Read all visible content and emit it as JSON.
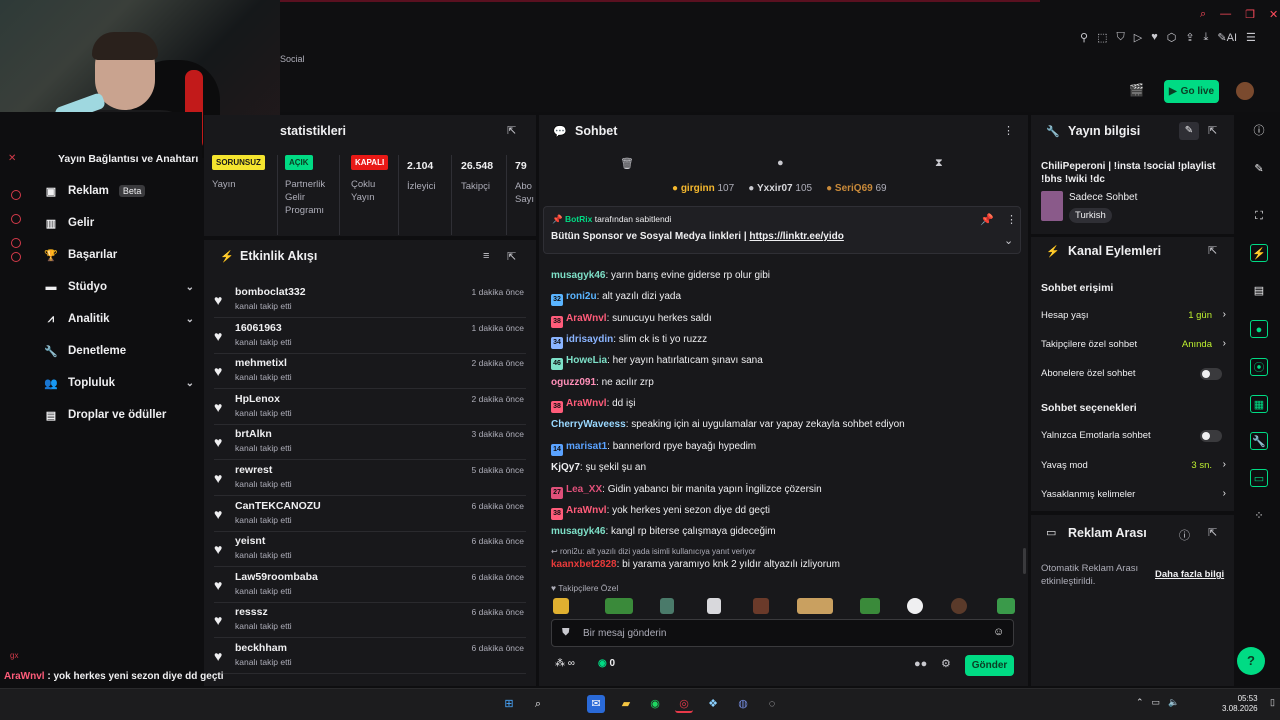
{
  "topbar": {
    "social_fragment": "Social",
    "go_live": "Go live"
  },
  "sidenav": {
    "partial_item": "Yayın Bağlantısı ve Anahtarı",
    "items": [
      {
        "label": "Reklam",
        "badge": "Beta",
        "icon": "megaphone-icon"
      },
      {
        "label": "Gelir",
        "icon": "revenue-icon"
      },
      {
        "label": "Başarılar",
        "icon": "trophy-icon"
      },
      {
        "label": "Stüdyo",
        "icon": "studio-icon"
      },
      {
        "label": "Analitik",
        "icon": "chart-icon"
      },
      {
        "label": "Denetleme",
        "icon": "wrench-icon"
      },
      {
        "label": "Topluluk",
        "icon": "community-icon"
      },
      {
        "label": "Droplar ve ödüller",
        "icon": "gift-icon"
      }
    ]
  },
  "stats": {
    "title_fragment": "statistikleri",
    "cells": [
      {
        "badge": "SORUNSUZ",
        "label": "Yayın"
      },
      {
        "badge": "AÇIK",
        "label": "Partnerlik Gelir Programı"
      },
      {
        "badge": "KAPALI",
        "label": "Çoklu Yayın"
      },
      {
        "value": "2.104",
        "label": "İzleyici"
      },
      {
        "value": "26.548",
        "label": "Takipçi"
      },
      {
        "value": "79",
        "label": "Abo Sayı"
      }
    ]
  },
  "activity": {
    "title": "Etkinlik Akışı",
    "sub": "kanalı takip etti",
    "rows": [
      {
        "name": "bomboclat332",
        "time": "1 dakika önce"
      },
      {
        "name": "16061963",
        "time": "1 dakika önce"
      },
      {
        "name": "mehmetixl",
        "time": "2 dakika önce"
      },
      {
        "name": "HpLenox",
        "time": "2 dakika önce"
      },
      {
        "name": "brtAlkn",
        "time": "3 dakika önce"
      },
      {
        "name": "rewrest",
        "time": "5 dakika önce"
      },
      {
        "name": "CanTEKCANOZU",
        "time": "6 dakika önce"
      },
      {
        "name": "yeisnt",
        "time": "6 dakika önce"
      },
      {
        "name": "Law59roombaba",
        "time": "6 dakika önce"
      },
      {
        "name": "resssz",
        "time": "6 dakika önce"
      },
      {
        "name": "beckhham",
        "time": "6 dakika önce"
      }
    ]
  },
  "chat": {
    "title": "Sohbet",
    "leaders": [
      {
        "name": "girginn",
        "count": "107"
      },
      {
        "name": "Yxxir07",
        "count": "105"
      },
      {
        "name": "SeriQ69",
        "count": "69"
      }
    ],
    "pinned_by": "BotRix",
    "pinned_suffix": "tarafından sabitlendi",
    "pinned_text": "Bütün Sponsor ve Sosyal Medya linkleri |",
    "pinned_link": "https://linktr.ee/yido",
    "messages": [
      {
        "user": "musagyk46",
        "text": ": yarın barış evine giderse rp olur gibi",
        "color": "#7ee0c8",
        "badge": ""
      },
      {
        "user": "roni2u",
        "text": ": alt yazılı dizi yada",
        "color": "#5ab4ff",
        "badge": "32"
      },
      {
        "user": "AraWnvl",
        "text": ": sunucuyu herkes saldı",
        "color": "#ff5c7a",
        "badge": "38"
      },
      {
        "user": "idrisaydin",
        "text": ": slim ck is ti yo ruzzz",
        "color": "#8ab4ff",
        "badge": "34"
      },
      {
        "user": "HoweLia",
        "text": ": her yayın hatırlatıcam şınavı sana",
        "color": "#7ee0c8",
        "badge": "46"
      },
      {
        "user": "oguzz091",
        "text": ": ne acılır zrp",
        "color": "#ff8fb8",
        "badge": ""
      },
      {
        "user": "AraWnvl",
        "text": ": dd işi",
        "color": "#ff5c7a",
        "badge": "38"
      },
      {
        "user": "CherryWaveess",
        "text": ": speaking için ai uygulamalar var yapay zekayla sohbet ediyon",
        "color": "#9ad8ff",
        "badge": ""
      },
      {
        "user": "marisat1",
        "text": ": bannerlord rpye bayağı hypedim",
        "color": "#5aa2ff",
        "badge": "14"
      },
      {
        "user": "KjQy7",
        "text": ":  şu şekil şu an",
        "color": "#efeff1",
        "badge": ""
      },
      {
        "user": "Lea_XX",
        "text": ": Gidin yabancı bir manita yapın İngilizce çözersin",
        "color": "#e0507a",
        "badge": "27"
      },
      {
        "user": "AraWnvl",
        "text": ": yok herkes yeni sezon diye dd geçti",
        "color": "#ff5c7a",
        "badge": "38"
      },
      {
        "user": "musagyk46",
        "text": ": kangl rp biterse çalışmaya gideceğim",
        "color": "#7ee0c8",
        "badge": ""
      }
    ],
    "reply_hint": "roni2u: alt yazılı dizi yada isimli kullanıcıya yanıt veriyor",
    "last_user": "kaanxbet2828",
    "last_text": ": bi yarama yaramıyo knk 2 yıldır altyazılı izliyorum",
    "followers_only": "Takipçilere Özel",
    "placeholder": "Bir mesaj gönderin",
    "infinite": "∞",
    "points": "0",
    "send": "Gönder"
  },
  "stream_info": {
    "title": "Yayın bilgisi",
    "desc": "ChiliPeperoni | !insta !social !playlist !bhs !wiki !dc",
    "category": "Sadece Sohbet",
    "tag": "Turkish"
  },
  "channel_actions": {
    "title": "Kanal Eylemleri",
    "access_title": "Sohbet erişimi",
    "account_age": "Hesap yaşı",
    "account_age_val": "1 gün",
    "followers_only": "Takipçilere özel sohbet",
    "followers_only_val": "Anında",
    "subs_only": "Abonelere özel sohbet",
    "options_title": "Sohbet seçenekleri",
    "emote_only": "Yalnızca Emotlarla sohbet",
    "slow_mode": "Yavaş mod",
    "slow_mode_val": "3 sn.",
    "banned_words": "Yasaklanmış kelimeler"
  },
  "ad_break": {
    "title": "Reklam Arası",
    "text": "Otomatik Reklam Arası etkinleştirildi.",
    "link": "Daha fazla bilgi"
  },
  "overlay_chat": [
    {
      "user": "AraWnvl",
      "text": " : yok herkes yeni sezon diye dd geçti",
      "color": "#ff5c7a"
    },
    {
      "user": "musagyk46",
      "text": " : kangl rp biterse çalışmaya gidec",
      "color": "#7ee0c8"
    },
    {
      "user": "kaanxbet2828",
      "text": " : bi yarama yaramıyo knk 2 yıld",
      "color": "#e83a3a"
    }
  ],
  "overlay_tag": "gx",
  "clock": {
    "time": "05:53",
    "date": "3.08.2026"
  },
  "colors": {
    "accent": "#00db84",
    "panel": "#18181b",
    "bg": "#0e0e10"
  }
}
